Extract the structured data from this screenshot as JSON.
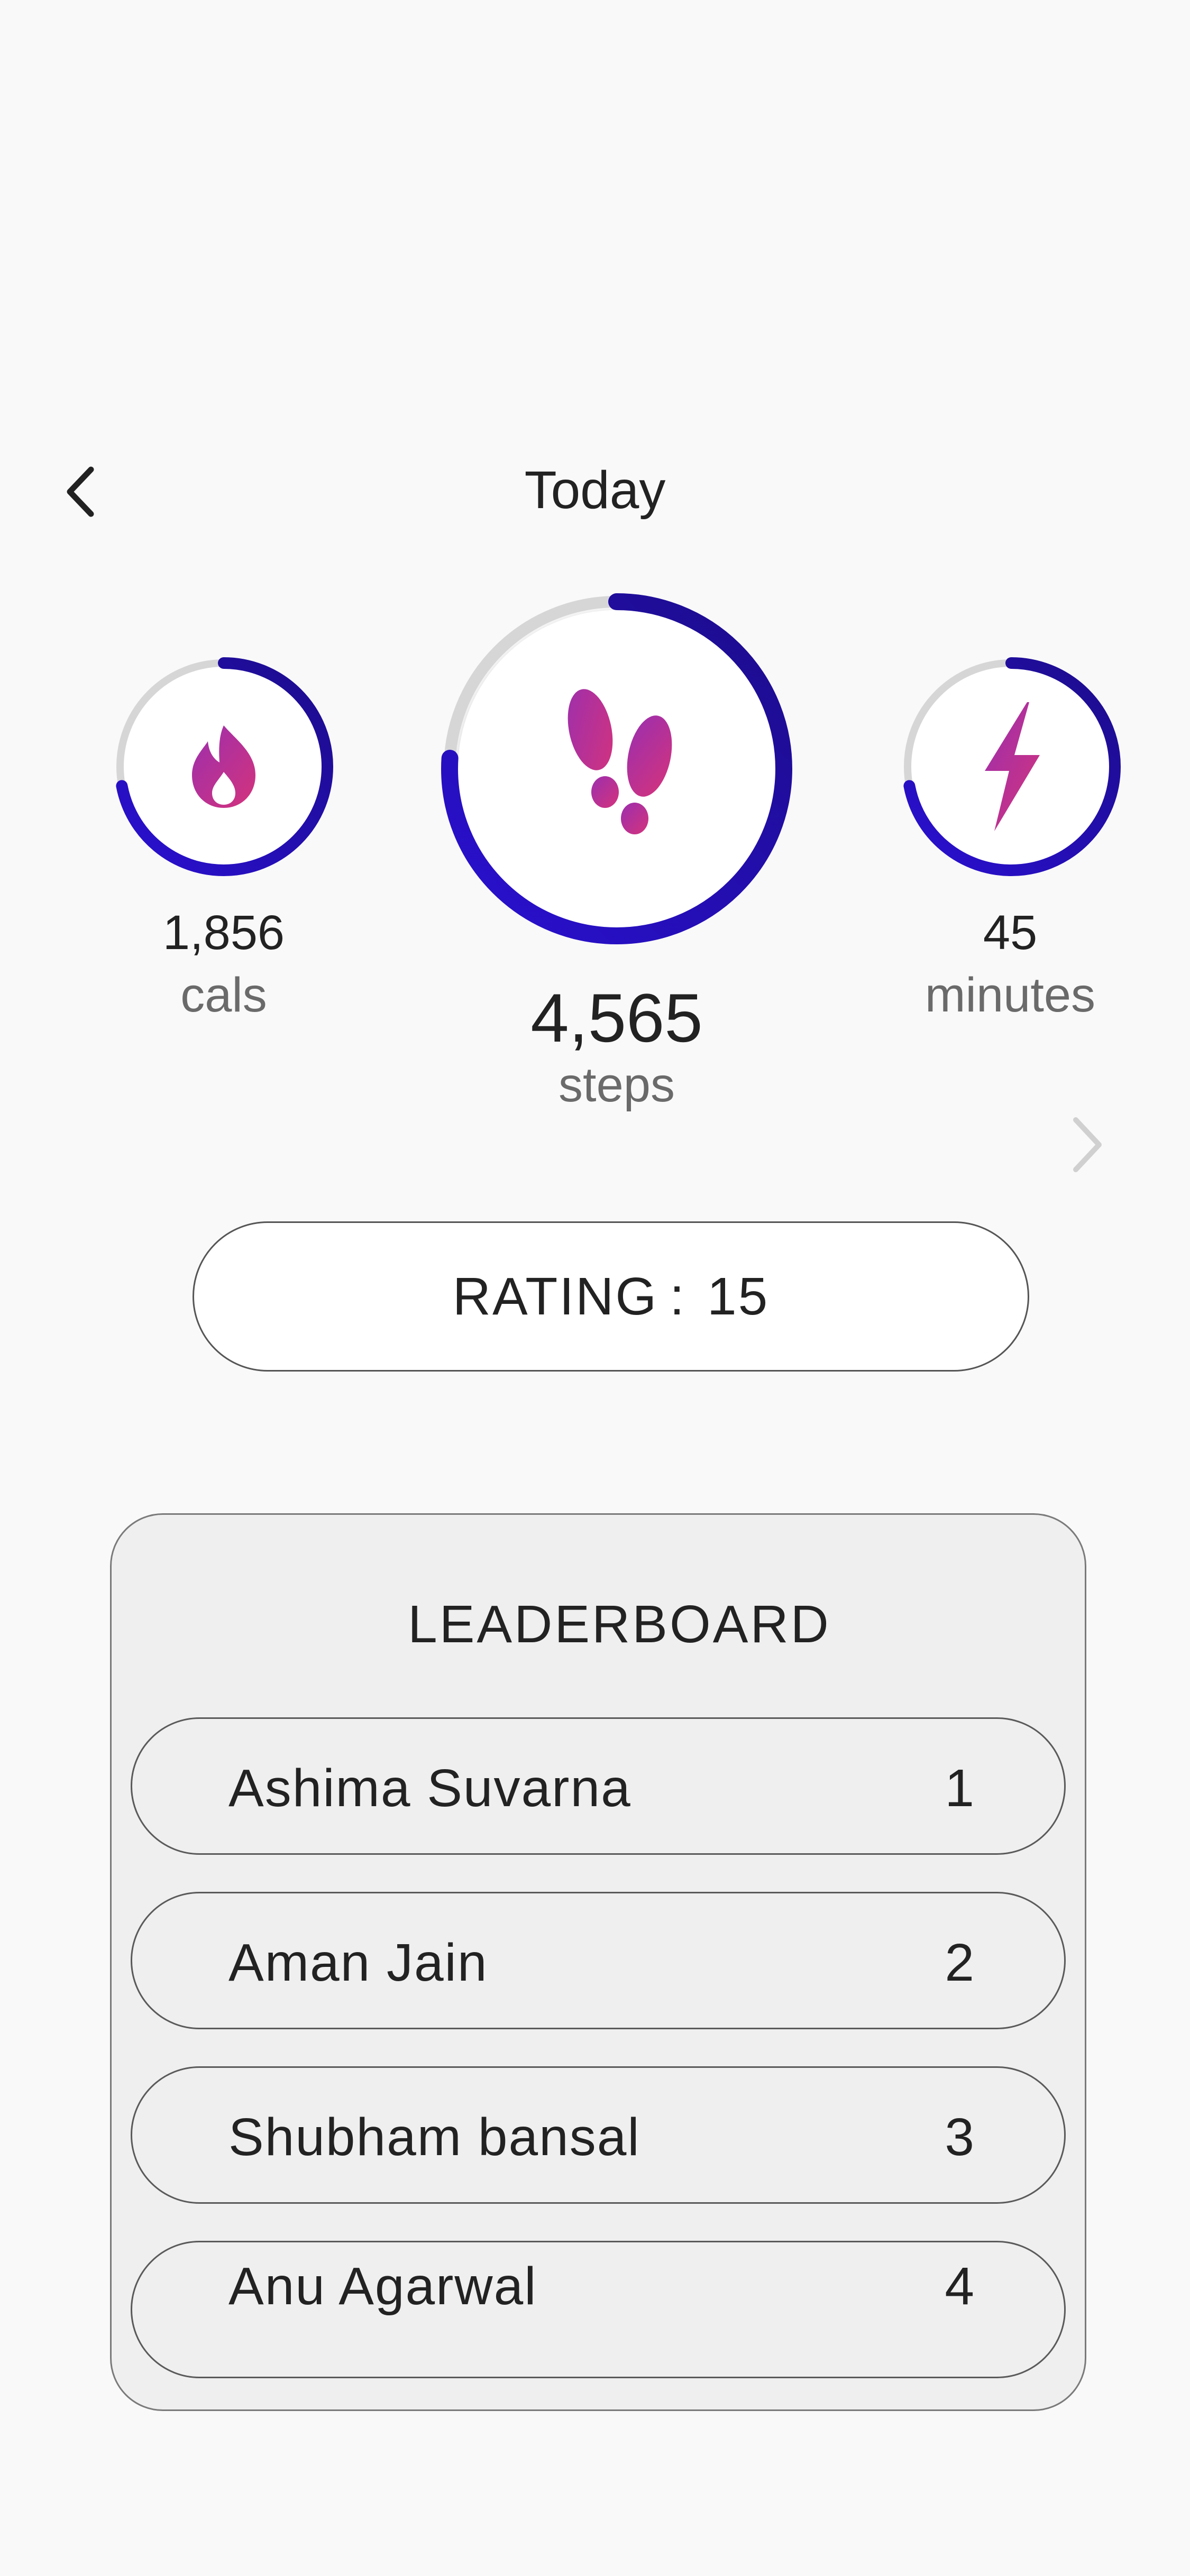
{
  "header": {
    "title": "Today"
  },
  "metrics": {
    "calories": {
      "value": "1,856",
      "unit": "cals",
      "icon": "flame-icon",
      "progress": 0.72
    },
    "steps": {
      "value": "4,565",
      "unit": "steps",
      "icon": "footprints-icon",
      "progress": 0.76
    },
    "minutes": {
      "value": "45",
      "unit": "minutes",
      "icon": "lightning-icon",
      "progress": 0.72
    }
  },
  "rating": {
    "label": "RATING",
    "separator": ":",
    "value": "15"
  },
  "leaderboard": {
    "title": "LEADERBOARD",
    "entries": [
      {
        "name": "Ashima Suvarna",
        "rank": "1"
      },
      {
        "name": "Aman Jain",
        "rank": "2"
      },
      {
        "name": "Shubham bansal",
        "rank": "3"
      },
      {
        "name": "Anu Agarwal",
        "rank": "4"
      }
    ]
  },
  "colors": {
    "ring_start": "#2a10d2",
    "ring_end": "#1c0c8a",
    "ring_track": "#d6d6d6",
    "icon_start": "#9b2fae",
    "icon_end": "#d4337c",
    "background": "#f9f9f9"
  }
}
